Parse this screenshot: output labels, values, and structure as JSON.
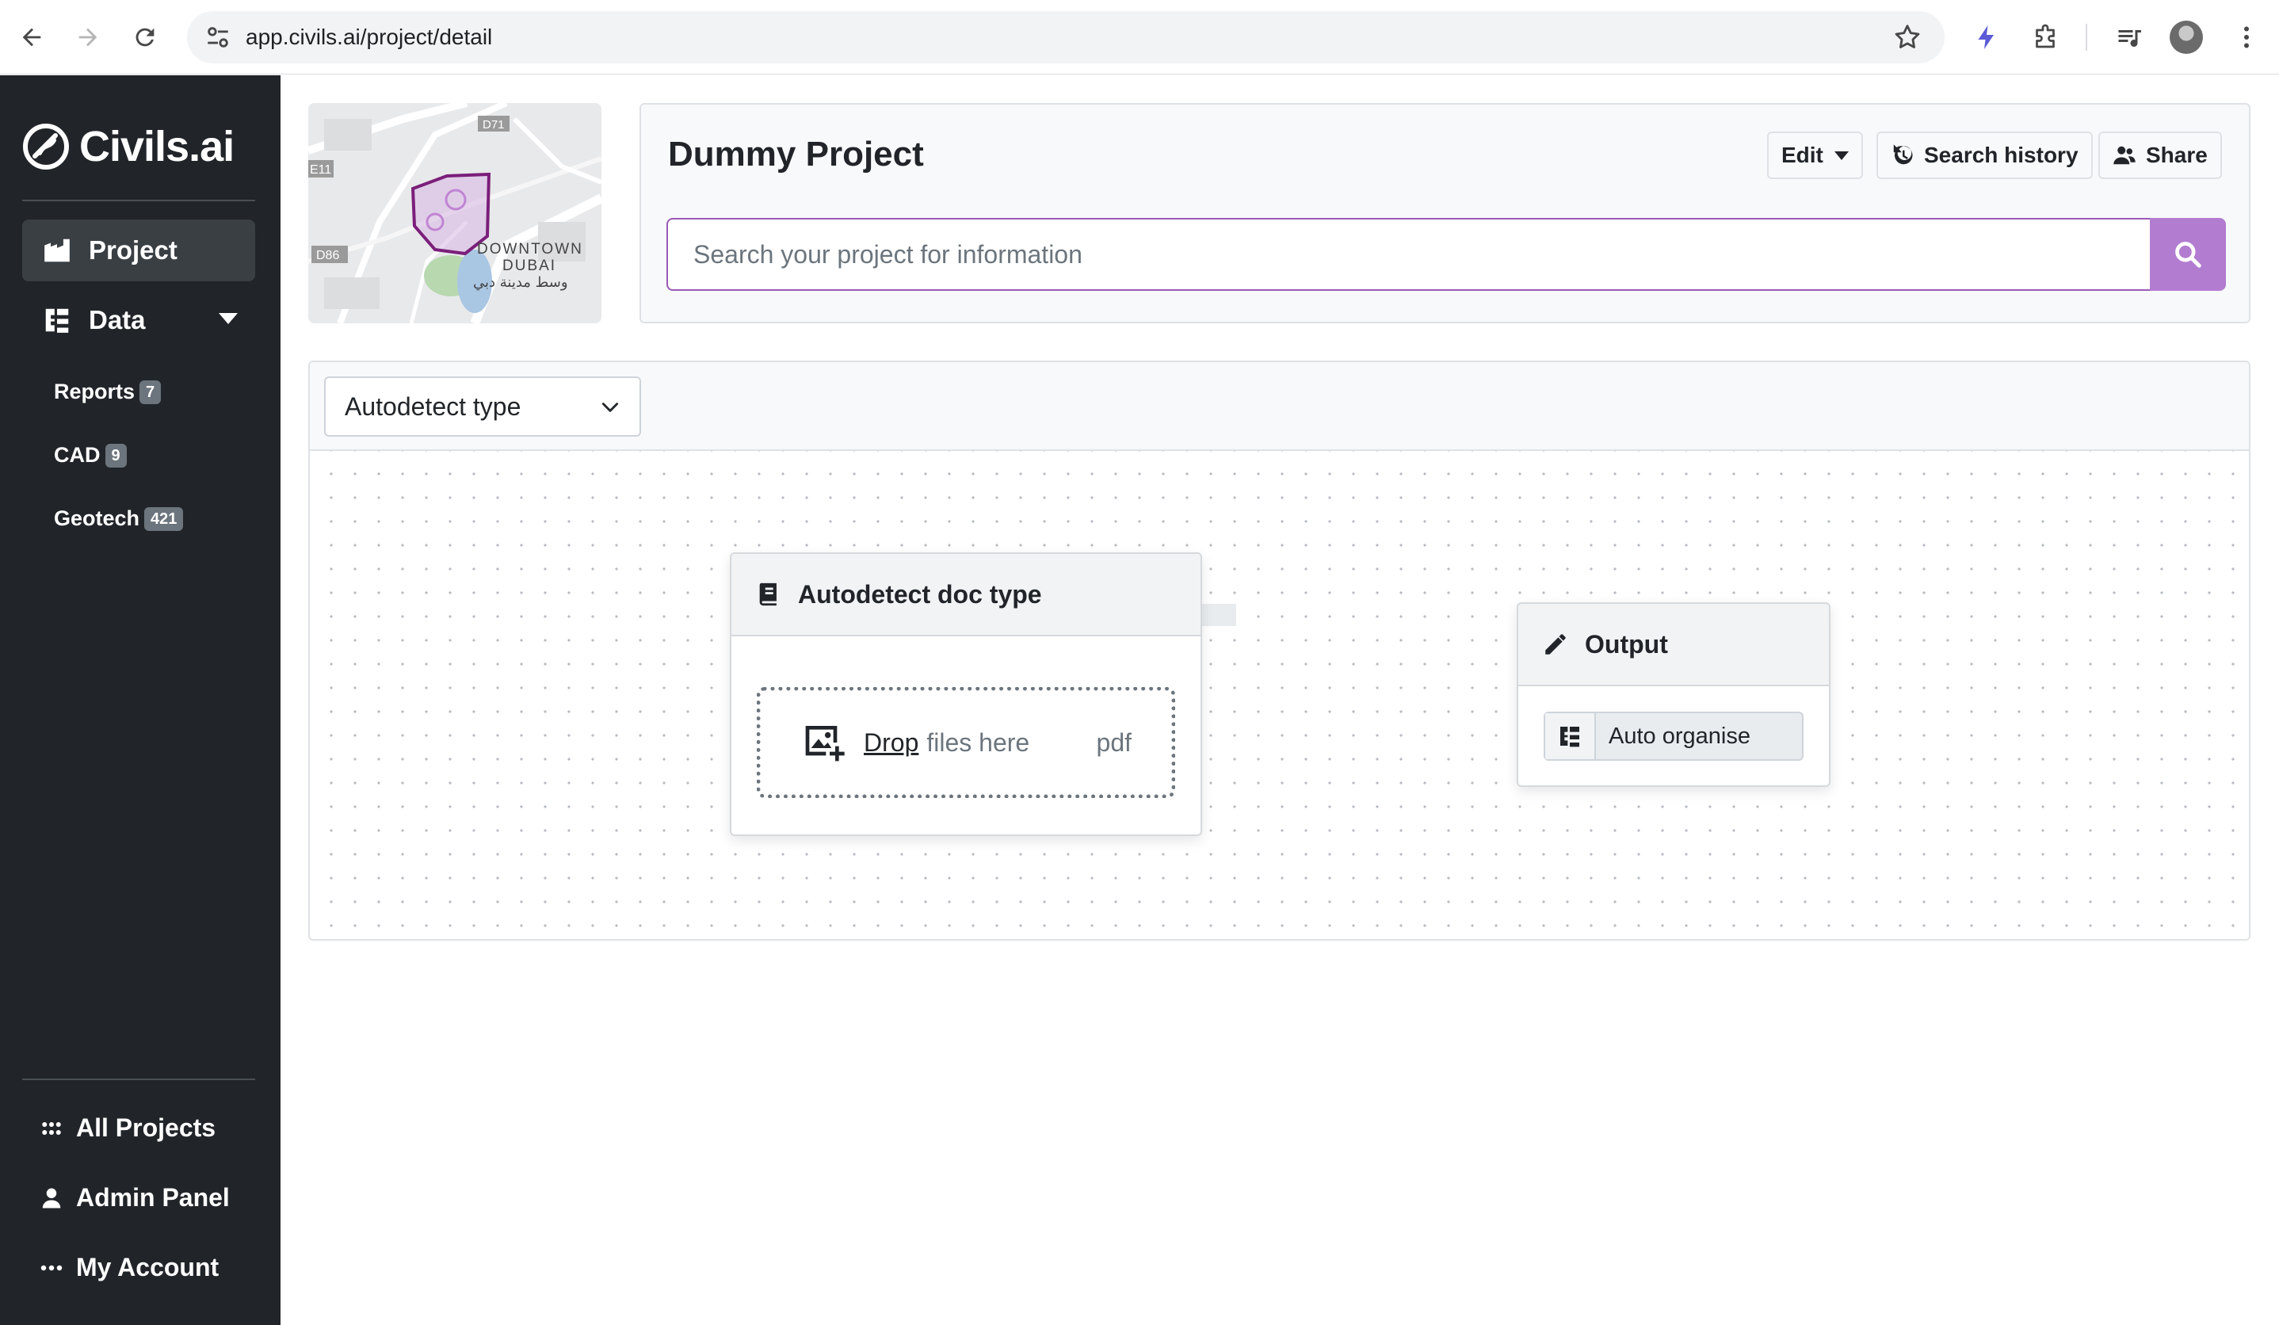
{
  "browser": {
    "url": "app.civils.ai/project/detail"
  },
  "sidebar": {
    "logo_text": "Civils.ai",
    "nav": [
      {
        "label": "Project",
        "icon": "building-icon",
        "active": true
      },
      {
        "label": "Data",
        "icon": "sitemap-icon",
        "active": false
      }
    ],
    "data_items": [
      {
        "label": "Reports",
        "count": "7"
      },
      {
        "label": "CAD",
        "count": "9"
      },
      {
        "label": "Geotech",
        "count": "421"
      }
    ],
    "bottom": [
      {
        "label": "All Projects",
        "icon": "grid-icon"
      },
      {
        "label": "Admin Panel",
        "icon": "user-icon"
      },
      {
        "label": "My Account",
        "icon": "ellipsis-icon"
      }
    ]
  },
  "map": {
    "labels": [
      "DOWNTOWN",
      "DUBAI",
      "وسط مدينة دبي"
    ],
    "road_labels": [
      "E11",
      "D86",
      "D71"
    ],
    "polygon_color": "#7b1e7a"
  },
  "header": {
    "project_title": "Dummy Project",
    "edit_label": "Edit",
    "history_label": "Search history",
    "share_label": "Share",
    "search_placeholder": "Search your project for information",
    "accent_color": "#b27cd0"
  },
  "flow": {
    "type_select": "Autodetect type",
    "input_node": {
      "title": "Autodetect doc type",
      "drop_word": "Drop",
      "drop_rest": "files here",
      "ext": "pdf"
    },
    "output_node": {
      "title": "Output",
      "action_label": "Auto organise"
    }
  }
}
